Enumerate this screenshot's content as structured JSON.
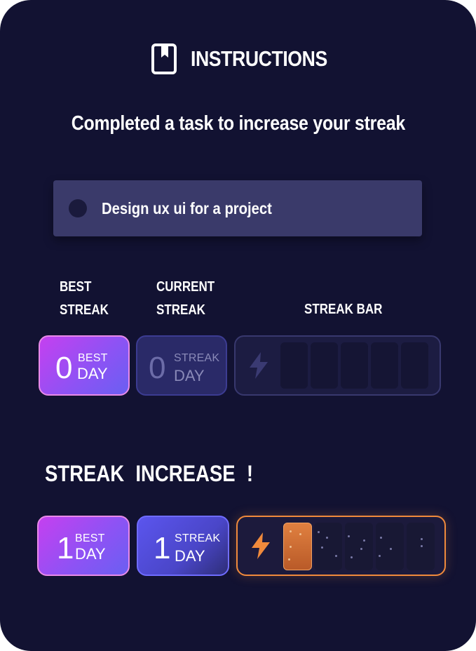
{
  "header": {
    "title": "INSTRUCTIONS",
    "icon": "book-icon"
  },
  "subtitle": "Completed a task to increase your streak",
  "task": {
    "label": "Design ux ui for a project",
    "completed": false
  },
  "labels": {
    "best_line1": "BEST",
    "best_line2": "STREAK",
    "current_line1": "CURRENT",
    "current_line2": "STREAK",
    "streak_bar": "STREAK BAR"
  },
  "before": {
    "best": {
      "value": "0",
      "top": "BEST",
      "bottom": "DAY"
    },
    "current": {
      "value": "0",
      "top": "STREAK",
      "bottom": "DAY"
    },
    "bar": {
      "filled": 0,
      "total": 5
    }
  },
  "section_title": "STREAK INCREASE !",
  "after": {
    "best": {
      "value": "1",
      "top": "BEST",
      "bottom": "DAY"
    },
    "current": {
      "value": "1",
      "top": "STREAK",
      "bottom": "DAY"
    },
    "bar": {
      "filled": 1,
      "total": 5
    }
  },
  "colors": {
    "background": "#121232",
    "accent_orange": "#f08a3c",
    "best_gradient_start": "#c540f0",
    "current_active": "#5b55ee"
  }
}
